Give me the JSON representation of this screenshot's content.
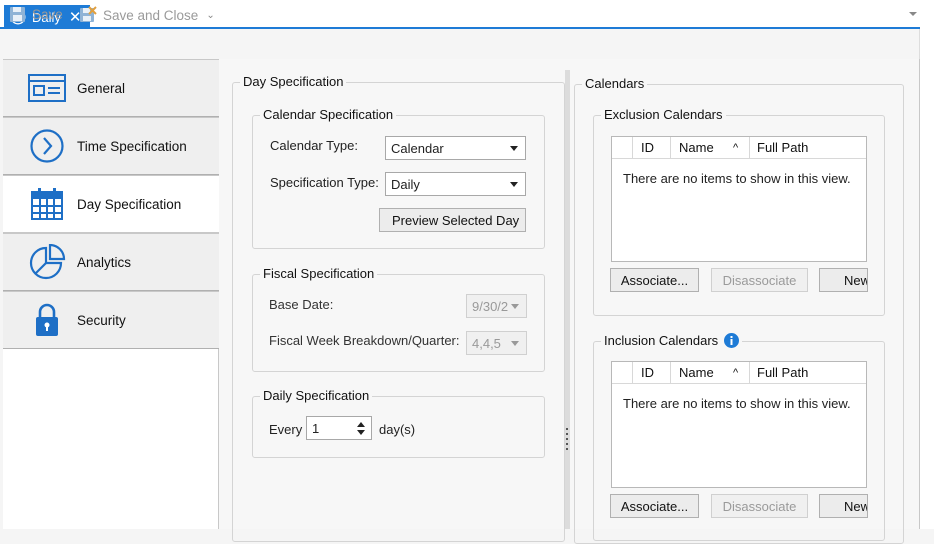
{
  "tab": {
    "label": "Daily",
    "close": "✕"
  },
  "toolbar": {
    "save_label": "Save",
    "save_close_label": "Save and Close",
    "more": "⌄"
  },
  "sidebar": {
    "items": [
      {
        "label": "General"
      },
      {
        "label": "Time Specification"
      },
      {
        "label": "Day Specification"
      },
      {
        "label": "Analytics"
      },
      {
        "label": "Security"
      }
    ]
  },
  "day_spec": {
    "title": "Day Specification",
    "calendar_spec": {
      "title": "Calendar Specification",
      "calendar_type_label": "Calendar Type:",
      "calendar_type_value": "Calendar",
      "spec_type_label": "Specification Type:",
      "spec_type_value": "Daily",
      "preview_button": "Preview Selected Day"
    },
    "fiscal_spec": {
      "title": "Fiscal Specification",
      "base_date_label": "Base Date:",
      "base_date_value": "9/30/2",
      "breakdown_label": "Fiscal Week Breakdown/Quarter:",
      "breakdown_value": "4,4,5"
    },
    "daily_spec": {
      "title": "Daily Specification",
      "every_label": "Every",
      "every_value": "1",
      "unit_label": "day(s)"
    }
  },
  "calendars": {
    "title": "Calendars",
    "exclusion": {
      "title": "Exclusion Calendars",
      "columns": [
        "ID",
        "Name",
        "^",
        "Full Path"
      ],
      "empty_text": "There are no items to show in this view.",
      "associate_button": "Associate...",
      "disassociate_button": "Disassociate",
      "new_button": "New"
    },
    "inclusion": {
      "title": "Inclusion Calendars",
      "columns": [
        "ID",
        "Name",
        "^",
        "Full Path"
      ],
      "empty_text": "There are no items to show in this view.",
      "associate_button": "Associate...",
      "disassociate_button": "Disassociate",
      "new_button": "New"
    }
  },
  "colors": {
    "accent": "#1e7bd6",
    "info": "#1e7bd6"
  }
}
